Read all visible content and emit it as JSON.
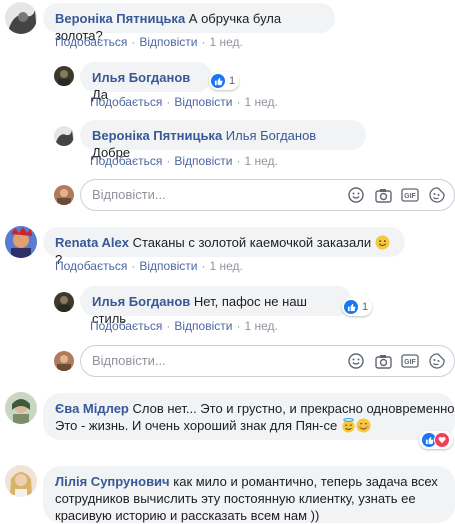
{
  "comments": [
    {
      "author": "Вероніка Пятницька",
      "text": "А обручка була золота?",
      "like": "Подобається",
      "reply": "Відповісти",
      "time": "1 нед.",
      "replies": [
        {
          "author": "Илья Богданов",
          "text": "Да",
          "like": "Подобається",
          "reply": "Відповісти",
          "time": "1 нед.",
          "reactions": "1"
        },
        {
          "author": "Вероніка Пятницька",
          "mention": "Илья Богданов",
          "text": "Добре",
          "like": "Подобається",
          "reply": "Відповісти",
          "time": "1 нед."
        }
      ],
      "reply_placeholder": "Відповісти..."
    },
    {
      "author": "Renata Alex",
      "text": "Стаканы с золотой каемочкой заказали",
      "text_after": "?",
      "like": "Подобається",
      "reply": "Відповісти",
      "time": "1 нед.",
      "replies": [
        {
          "author": "Илья Богданов",
          "text": "Нет, пафос не наш стиль",
          "like": "Подобається",
          "reply": "Відповісти",
          "time": "1 нед.",
          "reactions": "1"
        }
      ],
      "reply_placeholder": "Відповісти..."
    },
    {
      "author": "Єва Мідлер",
      "text_line1": "Слов нет... Это и грустно, и прекрасно одновременно.",
      "text_line2": "Это - жизнь. И очень хороший знак для Пян-се"
    },
    {
      "author": "Лілія Супрунович",
      "text_line1": "как мило и романтично, теперь задача всех",
      "text_line2": "сотрудников вычислить эту постоянную клиентку, узнать ее",
      "text_line3": "красивую историю и рассказать всем нам ))"
    }
  ],
  "icons": {
    "emoji": "smile-icon",
    "camera": "camera-icon",
    "gif": "gif-icon",
    "sticker": "sticker-icon",
    "like": "like-icon",
    "heart": "heart-icon"
  },
  "colors": {
    "name": "#385898",
    "bubble": "#f2f3f5",
    "like_blue": "#1877f2",
    "heart_red": "#f33e58",
    "meta_gray": "#90949c"
  },
  "gif_label": "GIF"
}
